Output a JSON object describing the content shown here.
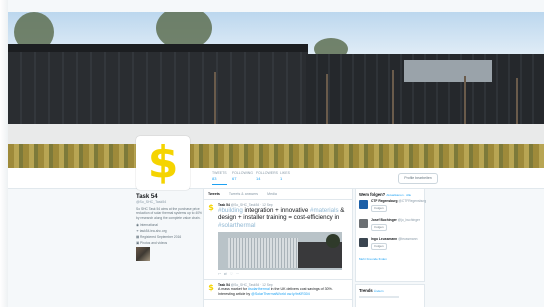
{
  "profile": {
    "name": "Task 54",
    "handle": "@So_SHC_Task54",
    "bio": "So SHC Task 54 aims at the purchase price reduction of solar thermal systems up to 40% by research along the complete value chain.",
    "location": "International",
    "website": "task54.iea-shc.org",
    "joined": "Registered September 2016",
    "photos_label": "Photos and videos"
  },
  "nav": {
    "stats": [
      {
        "label": "Tweets",
        "value": "83"
      },
      {
        "label": "Following",
        "value": "67"
      },
      {
        "label": "Followers",
        "value": "14"
      },
      {
        "label": "Likes",
        "value": "1"
      }
    ],
    "edit_button": "Profile bearbeiten"
  },
  "tweets_tabs": [
    "Tweets",
    "Tweets & answers",
    "Media"
  ],
  "tweets": [
    {
      "name": "Task 54",
      "handle": "@So_SHC_Task54",
      "time": "· 12 Sep",
      "text_parts": [
        {
          "t": "#building",
          "hash": true
        },
        {
          "t": " integration + innovative ",
          "hash": false
        },
        {
          "t": "#materials",
          "hash": true
        },
        {
          "t": " & design + installer training = cost-efficiency in ",
          "hash": false
        },
        {
          "t": "#solarthermal",
          "hash": true
        }
      ]
    },
    {
      "name": "Task 54",
      "handle": "@So_SHC_Task54",
      "time": "· 12 Sep",
      "text_parts": [
        {
          "t": "A mass market for ",
          "hash": false
        },
        {
          "t": "#solarthermal",
          "hash": true
        },
        {
          "t": " in the UK delivers cost savings of 30%. Interesting article by ",
          "hash": false
        },
        {
          "t": "@SolarThermalWorld",
          "hash": true
        },
        {
          "t": " ",
          "hash": false
        },
        {
          "t": "ow.ly/tnKR304",
          "hash": true
        }
      ]
    }
  ],
  "who_to_follow": {
    "title": "Wem folgen?",
    "refresh": "Aktualisieren · Alle",
    "follow_label": "Folgen",
    "more": "Mehr Freunde finden",
    "items": [
      {
        "name": "CTF Regensburg",
        "handle": "@CTFRegensburg",
        "color": "#1b5fa8"
      },
      {
        "name": "Josef Buchinger",
        "handle": "@jo_buchinger",
        "color": "#6b6f73"
      },
      {
        "name": "Ingo Leussmann",
        "handle": "@leussmann",
        "color": "#3a4550"
      }
    ]
  },
  "trends": {
    "title": "Trends",
    "change": "Ändern"
  },
  "colors": {
    "accent": "#1da1f2",
    "avatar_dollar": "#f5d400"
  }
}
